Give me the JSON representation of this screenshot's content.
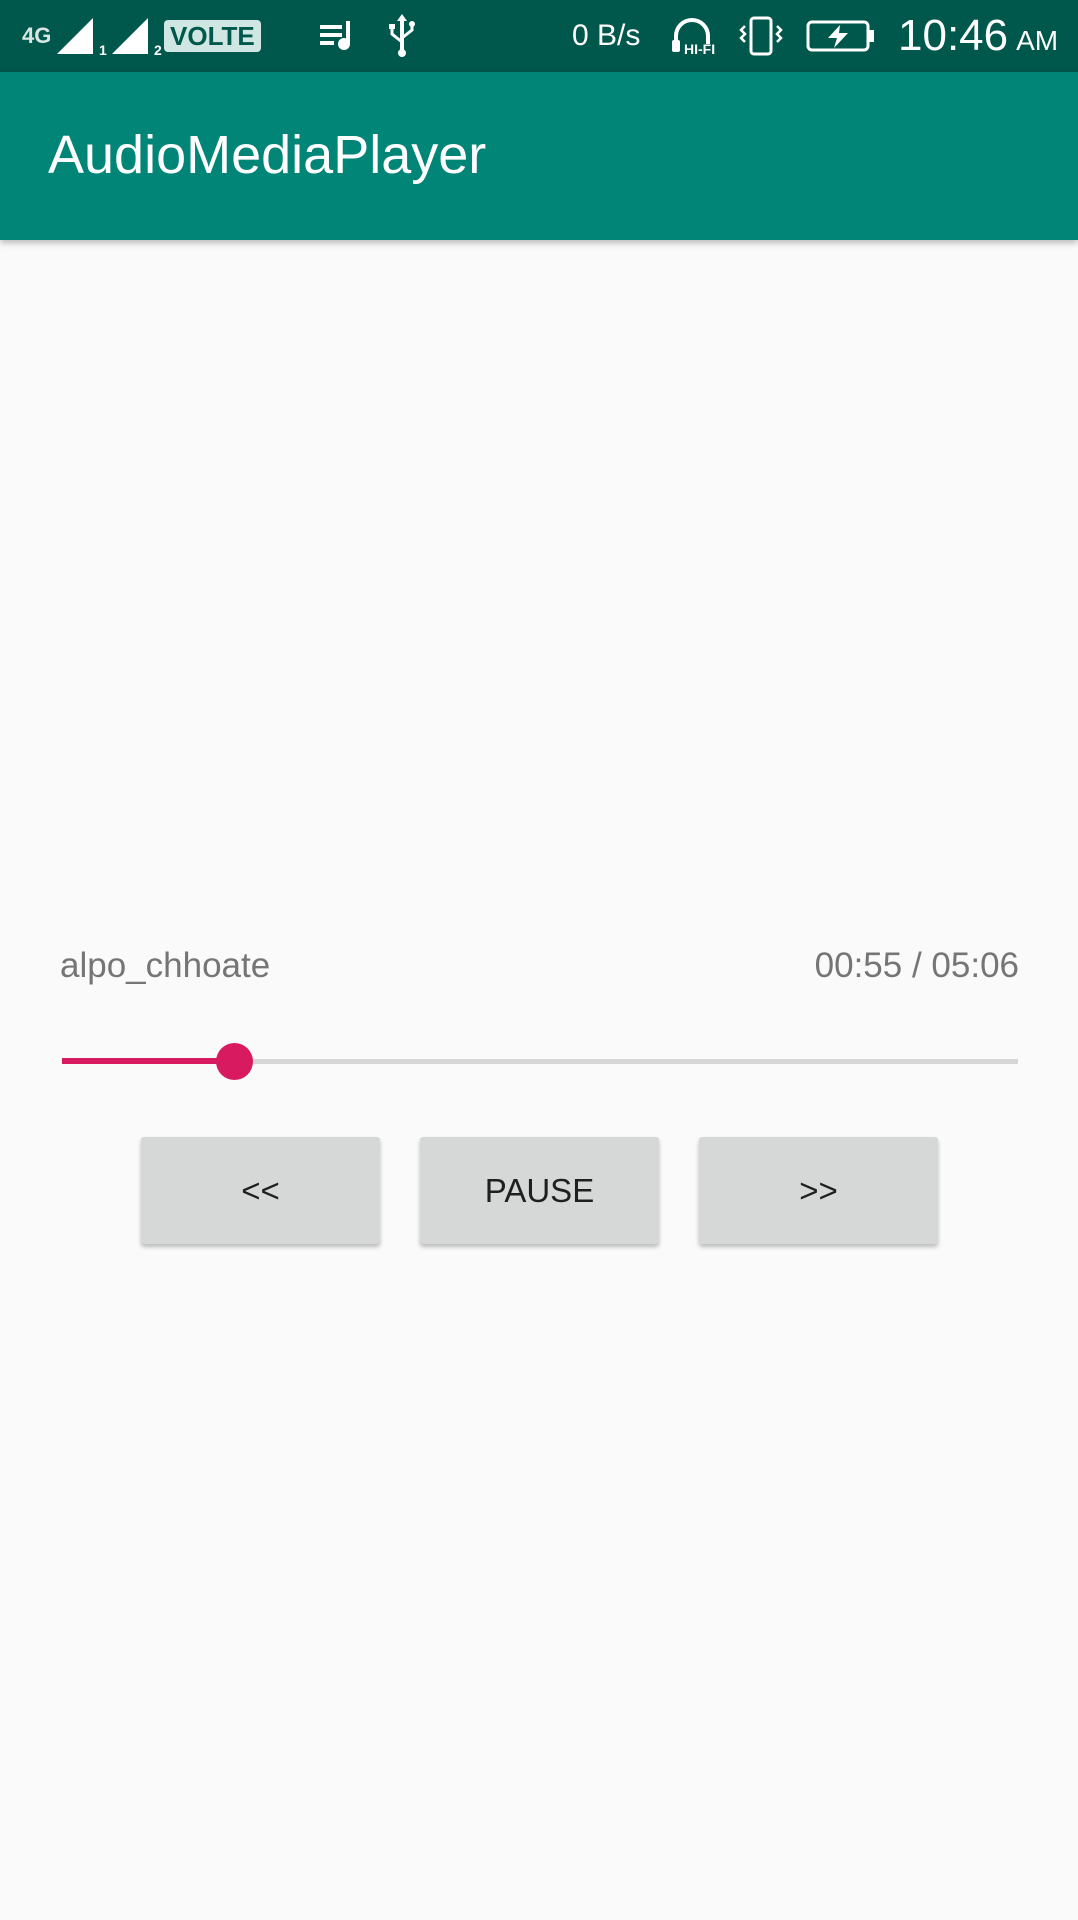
{
  "status_bar": {
    "network_type": "4G",
    "sim1": "1",
    "sim2": "2",
    "volte": "VOLTE",
    "data_speed": "0 B/s",
    "hifi": "HI-FI",
    "time": "10:46",
    "ampm": "AM",
    "icons": [
      "signal-4g-icon",
      "signal-sim1-icon",
      "signal-sim2-icon",
      "volte-icon",
      "playlist-icon",
      "usb-icon",
      "headphones-hifi-icon",
      "vibrate-icon",
      "battery-charging-icon"
    ],
    "text_color": "#ffffff",
    "background": "#00574b"
  },
  "app_bar": {
    "title": "AudioMediaPlayer",
    "background": "#008577"
  },
  "player": {
    "track_name": "alpo_chhoate",
    "time_display": "00:55 / 05:06",
    "progress_fraction": 0.18,
    "accent_color": "#d81b60",
    "buttons": {
      "previous_label": "<<",
      "pause_label": "PAUSE",
      "next_label": ">>"
    }
  }
}
